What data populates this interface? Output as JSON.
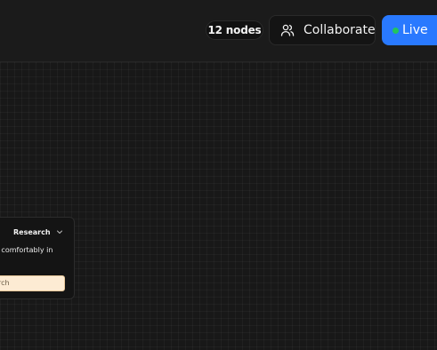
{
  "header": {
    "node_count": "12 nodes",
    "collaborate_label": "Collaborate",
    "live_label": "Live"
  },
  "icons": {
    "collaborate": "users-icon",
    "live": "status-dot",
    "node_menu": "chevron-down-icon"
  },
  "colors": {
    "background": "#181818",
    "accent": "#2979ff",
    "live_dot": "#22c55e",
    "input_bg": "#fdebd3"
  },
  "node": {
    "title": "Research",
    "text": "ive comfortably in",
    "input_value": "rch"
  }
}
